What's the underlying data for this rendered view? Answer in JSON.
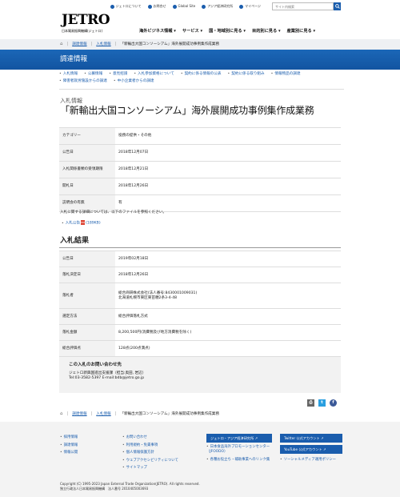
{
  "header": {
    "utility_links": [
      {
        "label": "ジェトロについて",
        "icon": "info-icon"
      },
      {
        "label": "お問合せ",
        "icon": "mail-icon"
      },
      {
        "label": "Global Site",
        "icon": "globe-icon"
      },
      {
        "label": "アジア経済研究所",
        "icon": "external-link-icon"
      },
      {
        "label": "マイページ",
        "icon": "user-icon"
      }
    ],
    "search_placeholder": "サイト内検索",
    "logo_text": "JETRO",
    "logo_sub": "日本貿易振興機構(ジェトロ)",
    "nav": [
      "海外ビジネス情報 ▾",
      "サービス ▾",
      "国・地域別に見る ▾",
      "目的別に見る ▾",
      "産業別に見る ▾"
    ]
  },
  "breadcrumb": {
    "items": [
      "調達情報",
      "入札情報",
      "「新輪出大国コンソーシアム」海外展開成功事例集作成業務"
    ]
  },
  "band": {
    "title": "調達情報"
  },
  "subnav": {
    "row1": [
      "入札情報",
      "公募情報",
      "意見招請",
      "入札参加資格について",
      "契約に係る情報の公表",
      "契約に係る取り組み",
      "情報物品の調達"
    ],
    "row2": [
      "障害者就労施設からの調達",
      "中小企業者からの調達"
    ]
  },
  "article": {
    "category": "入札情報",
    "title": "「新輸出大国コンソーシアム」海外展開成功事例集作成業務",
    "info_rows": [
      {
        "label": "カテゴリー",
        "value": "役務の提供・その他"
      },
      {
        "label": "公告日",
        "value": "2018年12月07日"
      },
      {
        "label": "入札関係書類の受領期限",
        "value": "2018年12月21日"
      },
      {
        "label": "開札日",
        "value": "2018年12月26日"
      },
      {
        "label": "説明会の有無",
        "value": "有"
      }
    ],
    "note": "入札に関する詳細については、以下のファイルを参照ください。",
    "pdf_link": "入札公告",
    "pdf_size": "(189KB)",
    "pdf_icon": "PDF",
    "result_heading": "入札結果",
    "result_rows": [
      {
        "label": "公告日",
        "value": "2019年02月18日"
      },
      {
        "label": "落札決定日",
        "value": "2018年12月26日"
      },
      {
        "label": "落札者",
        "value": "総合商研株式会社(法人番号:8430001009031)",
        "value2": "北海道札幌市東区東苗穂2条3-4-48"
      },
      {
        "label": "選定方法",
        "value": "総合評価落札方式"
      },
      {
        "label": "落札金額",
        "value": "8,200,500円(消費税及び地方消費税を除く)"
      },
      {
        "label": "総合評価点",
        "value": "128点(200点満点)"
      }
    ]
  },
  "contact": {
    "title": "この入札のお問い合わせ先",
    "dept": "ジェトロ新興国進出支援課（担当:奥田, 岩辺）",
    "tel": "Tel:03-3582-5397 E-mail:bdb@jetro.go.jp"
  },
  "share": {
    "print": "⎙",
    "twitter": "t",
    "facebook": "f"
  },
  "footer": {
    "col1": [
      "採用情報",
      "調達情報",
      "情報公開"
    ],
    "col2": [
      "お問い合わせ",
      "利用規約・免責事項",
      "個人情報保護方針",
      "ウェブアクセシビリティについて",
      "サイトマップ"
    ],
    "col3_button": "ジェトロ・アジア経済研究所 ↗",
    "col3": [
      "日本食品海外プロモーションセンター（JFOODO）",
      "各種お役立ち・補助事業へのリンク集"
    ],
    "col4_buttons": [
      "Twitter 公式アカウント ↗",
      "YouTube 公式アカウント ↗"
    ],
    "col4": [
      "ソーシャルメディア運用ポリシー"
    ],
    "copyright": "Copyright (C) 1995-2023 Japan External Trade Organization(JETRO). All rights reserved.",
    "corp_number": "独立行政法人日本貿易振興機構　法人番号 2010405003693"
  }
}
